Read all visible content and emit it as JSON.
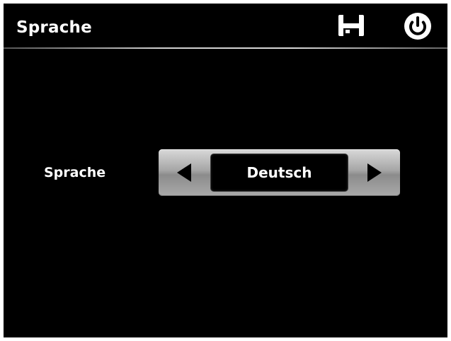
{
  "header": {
    "title": "Sprache",
    "save_icon": "floppy-disk-icon",
    "power_icon": "power-icon"
  },
  "setting": {
    "label": "Sprache",
    "value": "Deutsch",
    "prev_icon": "arrow-left-icon",
    "next_icon": "arrow-right-icon"
  },
  "colors": {
    "background": "#000000",
    "text": "#ffffff",
    "selector_gray": "#a6a6a6"
  }
}
